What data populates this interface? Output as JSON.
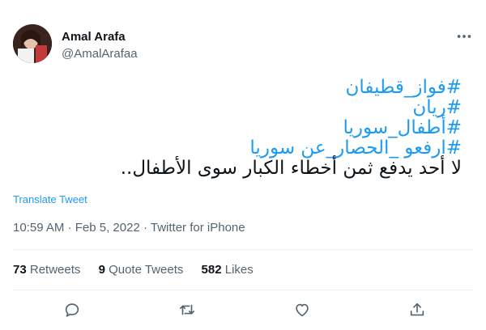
{
  "author": {
    "name": "Amal Arafa",
    "handle": "@AmalArafaa"
  },
  "tweet": {
    "hashtags": [
      "#فواز_قطيفان",
      "#ريان",
      "#أطفال_سوريا",
      "#ارفعو _الحصار_عن سوريا"
    ],
    "body": "لا أحد يدفع  ثمن أخطاء الكبار سوى الأطفال.."
  },
  "translate_label": "Translate Tweet",
  "meta": {
    "time": "10:59 AM",
    "separator": "·",
    "date": "Feb 5, 2022",
    "source": "Twitter for iPhone"
  },
  "stats": {
    "retweets_count": "73",
    "retweets_label": "Retweets",
    "quotes_count": "9",
    "quotes_label": "Quote Tweets",
    "likes_count": "582",
    "likes_label": "Likes"
  },
  "actions": [
    "reply-icon",
    "retweet-icon",
    "like-icon",
    "share-icon"
  ],
  "colors": {
    "link": "#1d9bf0",
    "text": "#0f1419",
    "muted": "#536471",
    "divider": "#eff3f4"
  }
}
